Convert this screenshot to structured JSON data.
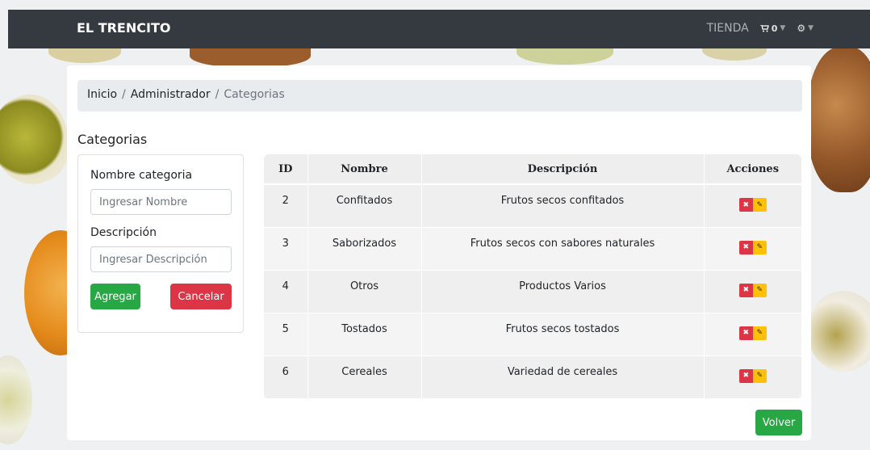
{
  "navbar": {
    "brand": "EL TRENCITO",
    "store_label": "TIENDA",
    "cart_icon": "cart-icon",
    "cart_count": "0",
    "settings_icon": "gear-icon"
  },
  "breadcrumb": {
    "home": "Inicio",
    "admin": "Administrador",
    "current": "Categorias",
    "separator": "/"
  },
  "page_title": "Categorias",
  "form": {
    "name_label": "Nombre categoria",
    "name_placeholder": "Ingresar Nombre",
    "desc_label": "Descripción",
    "desc_placeholder": "Ingresar Descripción",
    "add_label": "Agregar",
    "cancel_label": "Cancelar"
  },
  "table": {
    "headers": [
      "ID",
      "Nombre",
      "Descripción",
      "Acciones"
    ],
    "rows": [
      {
        "id": "2",
        "name": "Confitados",
        "description": "Frutos secos confitados"
      },
      {
        "id": "3",
        "name": "Saborizados",
        "description": "Frutos secos con sabores naturales"
      },
      {
        "id": "4",
        "name": "Otros",
        "description": "Productos Varios"
      },
      {
        "id": "5",
        "name": "Tostados",
        "description": "Frutos secos tostados"
      },
      {
        "id": "6",
        "name": "Cereales",
        "description": "Variedad de cereales"
      }
    ]
  },
  "back_label": "Volver",
  "colors": {
    "navbar": "#343a40",
    "success": "#28a745",
    "danger": "#dc3545",
    "warning": "#ffc107"
  }
}
